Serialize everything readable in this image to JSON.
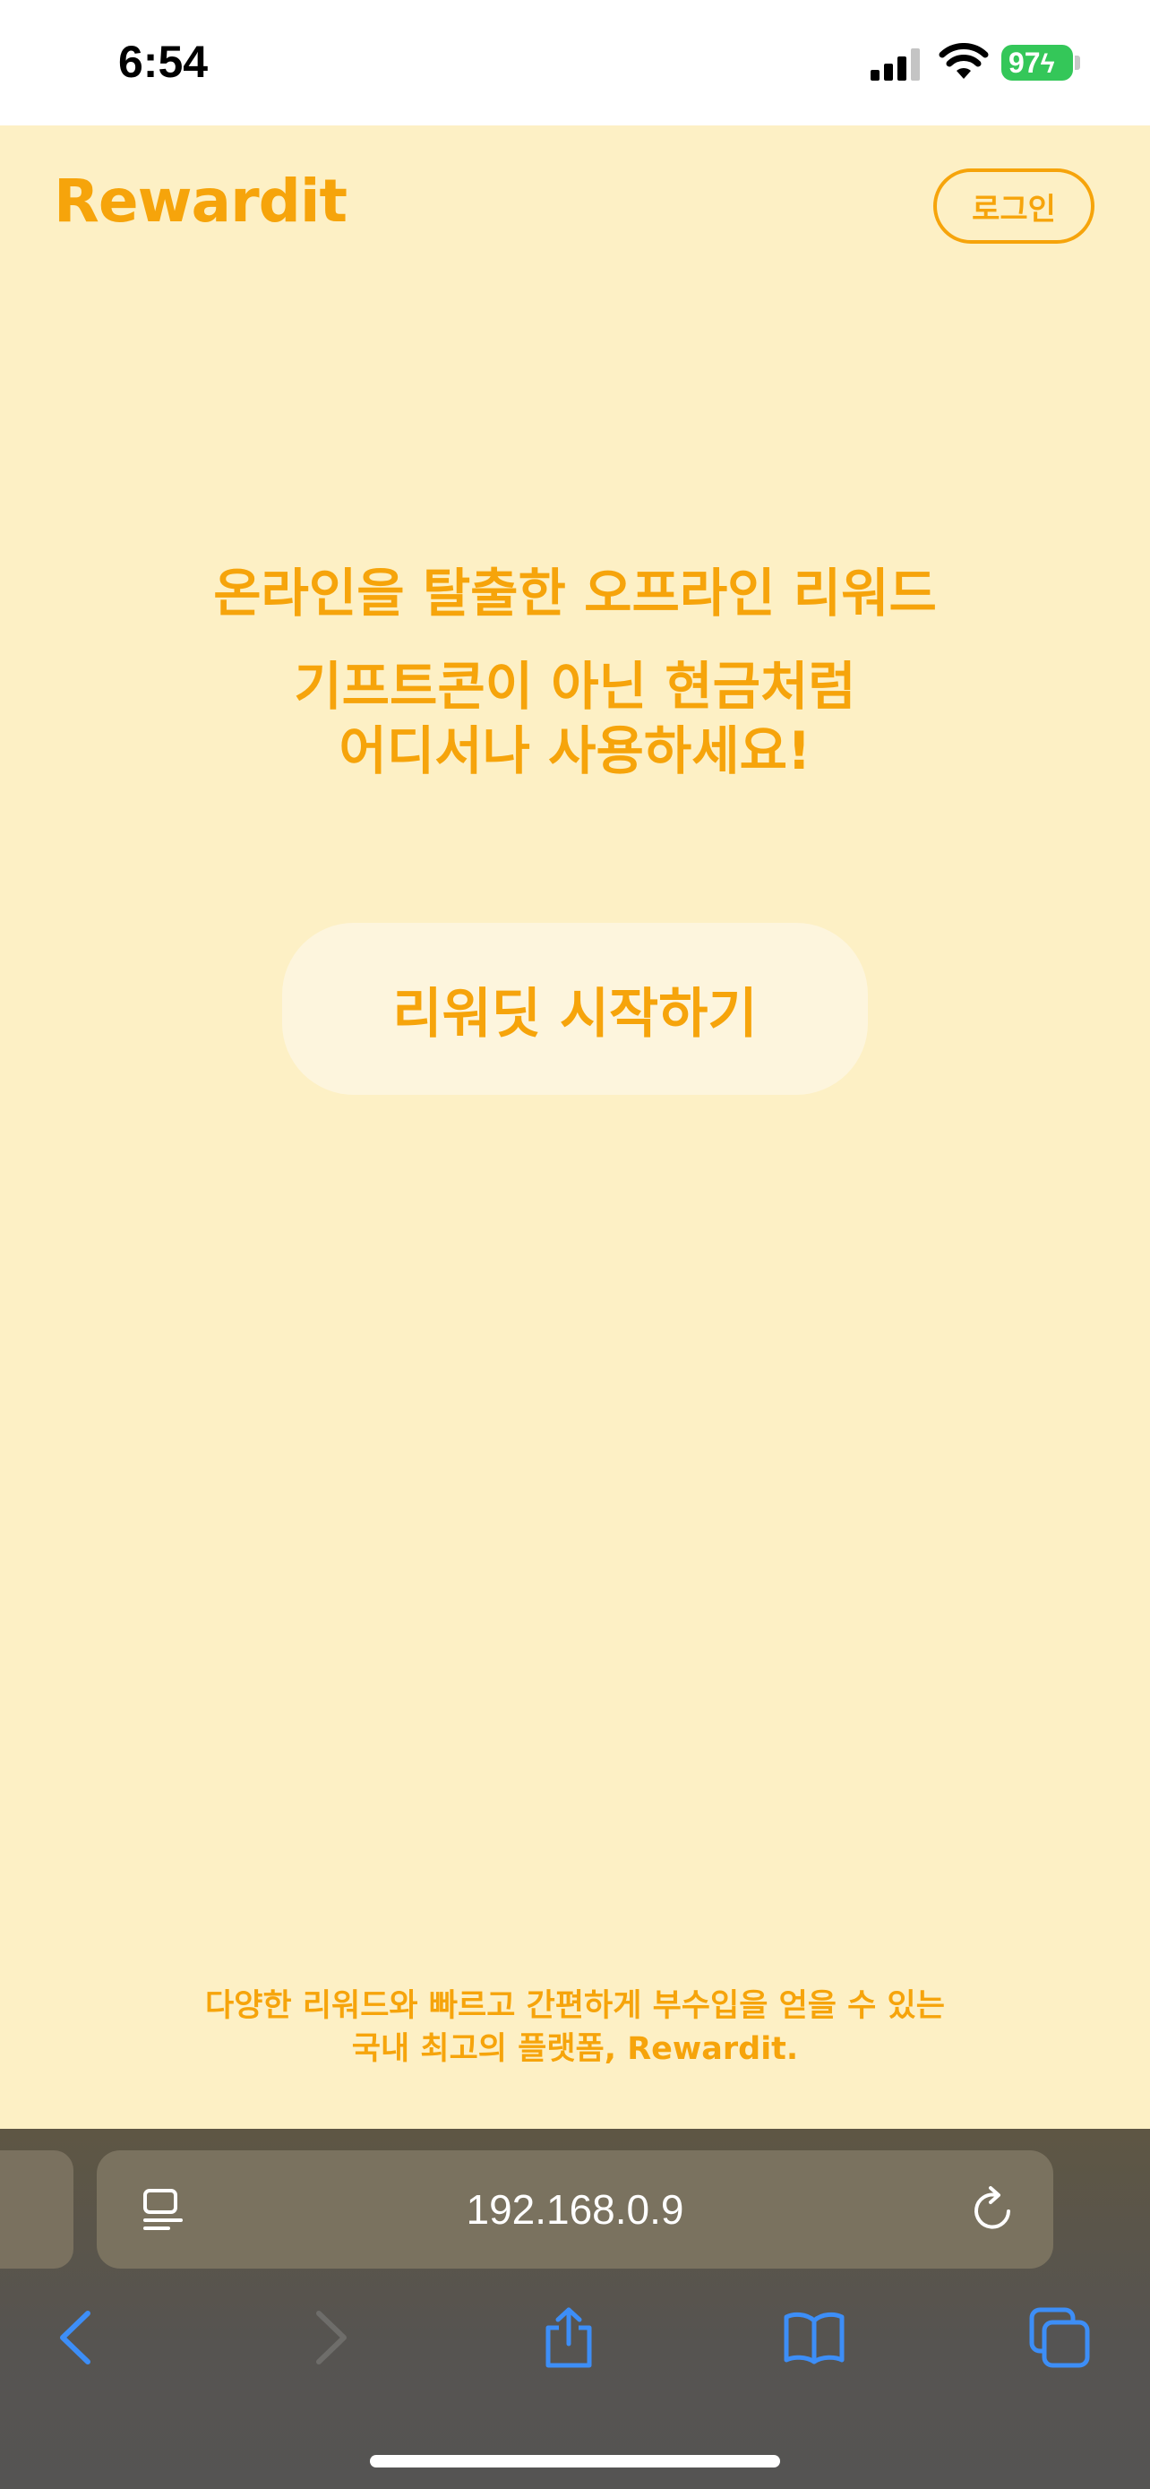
{
  "status_bar": {
    "time": "6:54",
    "battery": "97"
  },
  "header": {
    "brand": "Rewardit",
    "login_label": "로그인"
  },
  "hero": {
    "line1": "온라인을 탈출한 오프라인 리워드",
    "line2": "기프트콘이 아닌 현금처럼",
    "line3": "어디서나 사용하세요!",
    "start_label": "리워딧 시작하기"
  },
  "footer": {
    "line1": "다양한 리워드와 빠르고 간편하게 부수입을 얻을 수 있는",
    "line2": "국내 최고의 플랫폼, Rewardit."
  },
  "browser": {
    "url": "192.168.0.9"
  },
  "colors": {
    "brand_orange": "#f6a40b",
    "page_bg": "#fdf0c5",
    "button_bg": "#fdf5dd",
    "ios_blue": "#3d8ef7"
  },
  "icons": [
    "reader-icon",
    "reload-icon",
    "back-icon",
    "forward-icon",
    "share-icon",
    "bookmarks-icon",
    "tabs-icon"
  ]
}
